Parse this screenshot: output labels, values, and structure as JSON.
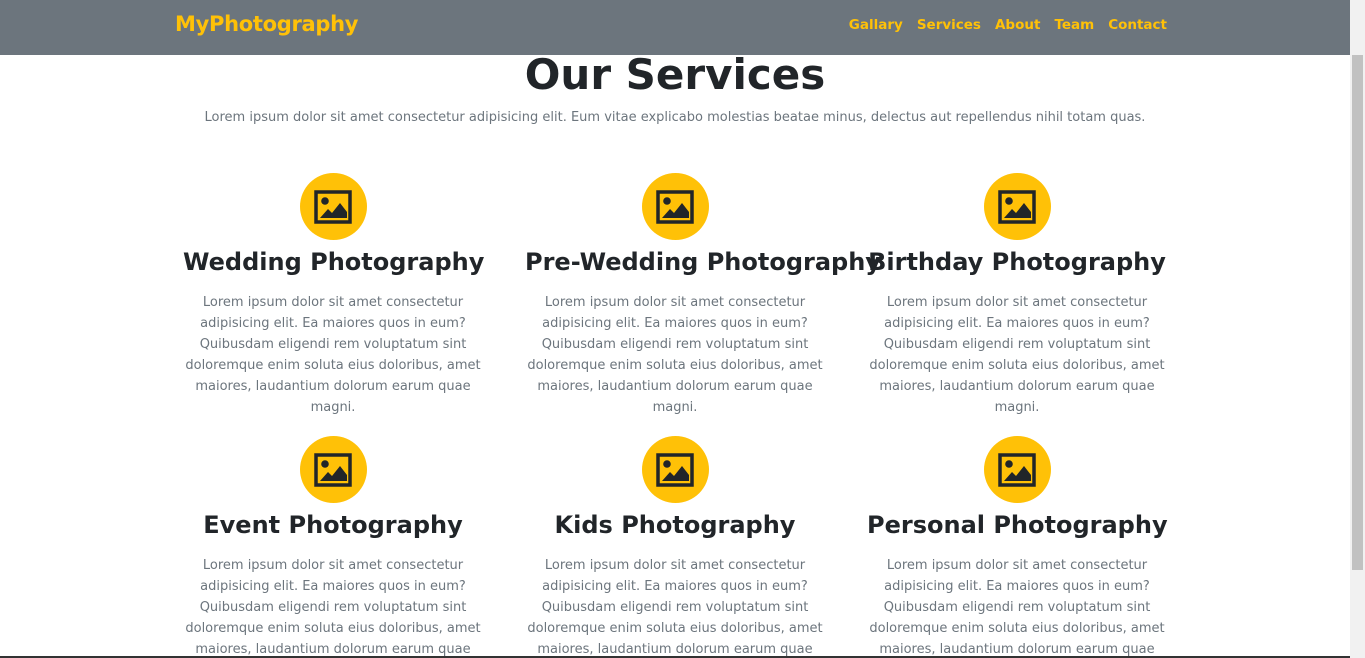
{
  "navbar": {
    "brand": "MyPhotography",
    "links": [
      "Gallary",
      "Services",
      "About",
      "Team",
      "Contact"
    ]
  },
  "section": {
    "title": "Our Services",
    "subtitle": "Lorem ipsum dolor sit amet consectetur adipisicing elit. Eum vitae explicabo molestias beatae minus, delectus aut repellendus nihil totam quas."
  },
  "services": [
    {
      "title": "Wedding Photography",
      "icon": "image-icon",
      "text": "Lorem ipsum dolor sit amet consectetur adipisicing elit. Ea maiores quos in eum? Quibusdam eligendi rem voluptatum sint doloremque enim soluta eius doloribus, amet maiores, laudantium dolorum earum quae magni."
    },
    {
      "title": "Pre-Wedding Photography",
      "icon": "image-icon",
      "text": "Lorem ipsum dolor sit amet consectetur adipisicing elit. Ea maiores quos in eum? Quibusdam eligendi rem voluptatum sint doloremque enim soluta eius doloribus, amet maiores, laudantium dolorum earum quae magni."
    },
    {
      "title": "Birthday Photography",
      "icon": "image-icon",
      "text": "Lorem ipsum dolor sit amet consectetur adipisicing elit. Ea maiores quos in eum? Quibusdam eligendi rem voluptatum sint doloremque enim soluta eius doloribus, amet maiores, laudantium dolorum earum quae magni."
    },
    {
      "title": "Event Photography",
      "icon": "image-icon",
      "text": "Lorem ipsum dolor sit amet consectetur adipisicing elit. Ea maiores quos in eum? Quibusdam eligendi rem voluptatum sint doloremque enim soluta eius doloribus, amet maiores, laudantium dolorum earum quae magni."
    },
    {
      "title": "Kids Photography",
      "icon": "image-icon",
      "text": "Lorem ipsum dolor sit amet consectetur adipisicing elit. Ea maiores quos in eum? Quibusdam eligendi rem voluptatum sint doloremque enim soluta eius doloribus, amet maiores, laudantium dolorum earum quae magni."
    },
    {
      "title": "Personal Photography",
      "icon": "image-icon",
      "text": "Lorem ipsum dolor sit amet consectetur adipisicing elit. Ea maiores quos in eum? Quibusdam eligendi rem voluptatum sint doloremque enim soluta eius doloribus, amet maiores, laudantium dolorum earum quae magni."
    }
  ],
  "colors": {
    "navbar_bg": "#6c757d",
    "accent": "#ffc107",
    "heading": "#212529",
    "muted_text": "#6c757d"
  }
}
